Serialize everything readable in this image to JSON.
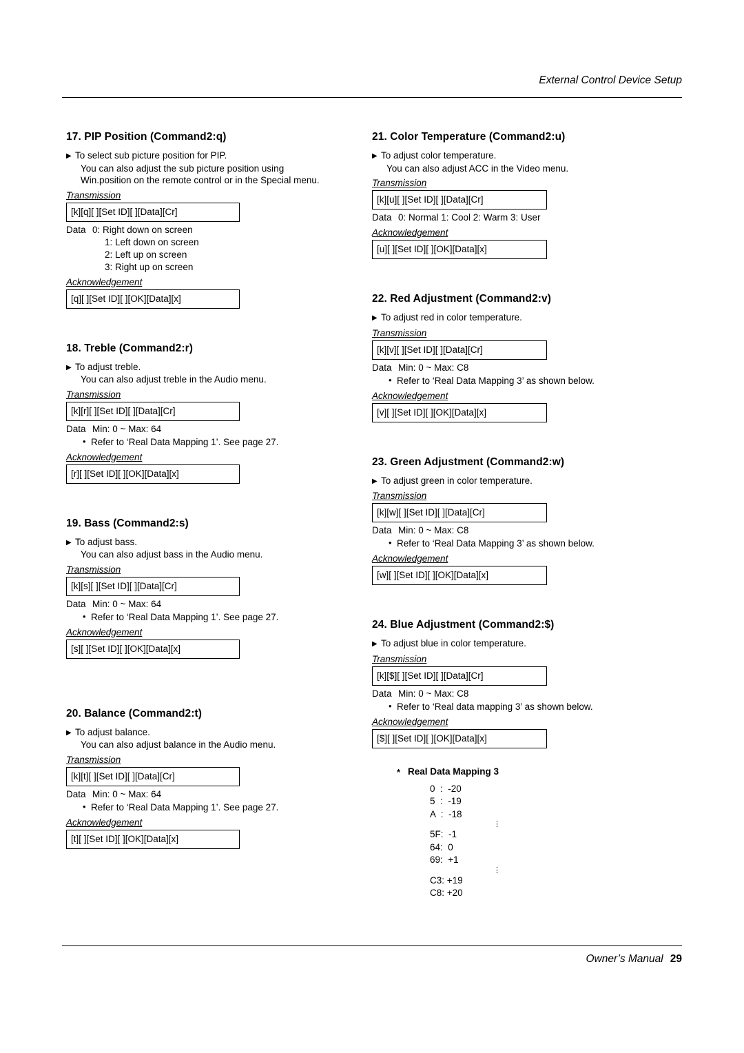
{
  "header": {
    "title": "External Control Device Setup"
  },
  "footer": {
    "manual": "Owner’s Manual",
    "page": "29"
  },
  "left_column": {
    "sections": [
      {
        "title": "17. PIP Position (Command2:q)",
        "bullet": "To select sub picture position for PIP.",
        "sublines": [
          "You can also adjust the sub picture position using",
          "Win.position on the remote control or in the Special menu."
        ],
        "transmission_label": "Transmission",
        "transmission_code": "[k][q][  ][Set ID][  ][Data][Cr]",
        "data_label": "Data",
        "data_value": "0: Right down on screen",
        "data_list": [
          "1: Left down on screen",
          "2: Left up on screen",
          "3: Right up on screen"
        ],
        "ack_label": "Acknowledgement",
        "ack_code": "[q][  ][Set ID][  ][OK][Data][x]"
      },
      {
        "title": "18. Treble (Command2:r)",
        "bullet": "To adjust treble.",
        "sublines": [
          "You can also adjust treble in the Audio menu."
        ],
        "transmission_label": "Transmission",
        "transmission_code": "[k][r][  ][Set ID][  ][Data][Cr]",
        "data_label": "Data",
        "data_value": "Min: 0 ~ Max: 64",
        "note": "Refer to ‘Real Data Mapping 1’. See page 27.",
        "ack_label": "Acknowledgement",
        "ack_code": "[r][  ][Set ID][  ][OK][Data][x]"
      },
      {
        "title": "19. Bass (Command2:s)",
        "bullet": "To adjust bass.",
        "sublines": [
          "You can also adjust bass in the Audio menu."
        ],
        "transmission_label": "Transmission",
        "transmission_code": "[k][s][  ][Set ID][  ][Data][Cr]",
        "data_label": "Data",
        "data_value": "Min: 0 ~ Max: 64",
        "note": "Refer to ‘Real Data Mapping 1’. See page 27.",
        "ack_label": "Acknowledgement",
        "ack_code": "[s][  ][Set ID][  ][OK][Data][x]"
      },
      {
        "title": "20. Balance (Command2:t)",
        "bullet": "To adjust balance.",
        "sublines": [
          "You can also adjust balance in the Audio menu."
        ],
        "transmission_label": "Transmission",
        "transmission_code": "[k][t][  ][Set ID][  ][Data][Cr]",
        "data_label": "Data",
        "data_value": "Min: 0 ~ Max: 64",
        "note": "Refer to ‘Real Data Mapping 1’. See page 27.",
        "ack_label": "Acknowledgement",
        "ack_code": "[t][  ][Set ID][  ][OK][Data][x]"
      }
    ]
  },
  "right_column": {
    "sections": [
      {
        "title": "21. Color Temperature (Command2:u)",
        "bullet": "To adjust color temperature.",
        "sublines": [
          "You can also adjust ACC in the Video menu."
        ],
        "transmission_label": "Transmission",
        "transmission_code": "[k][u][  ][Set ID][  ][Data][Cr]",
        "data_label": "Data",
        "data_value": "0: Normal      1: Cool      2: Warm      3: User",
        "ack_label": "Acknowledgement",
        "ack_code": "[u][  ][Set ID][  ][OK][Data][x]"
      },
      {
        "title": "22. Red Adjustment (Command2:v)",
        "bullet": "To adjust red in color temperature.",
        "transmission_label": "Transmission",
        "transmission_code": "[k][v][  ][Set ID][  ][Data][Cr]",
        "data_label": "Data",
        "data_value": "Min: 0 ~ Max: C8",
        "note": "Refer to ‘Real Data Mapping 3’ as shown below.",
        "ack_label": "Acknowledgement",
        "ack_code": "[v][  ][Set ID][  ][OK][Data][x]"
      },
      {
        "title": "23. Green Adjustment (Command2:w)",
        "bullet": "To adjust green in color temperature.",
        "transmission_label": "Transmission",
        "transmission_code": "[k][w][  ][Set ID][  ][Data][Cr]",
        "data_label": "Data",
        "data_value": "Min: 0 ~ Max: C8",
        "note": "Refer to ‘Real Data Mapping 3’ as shown below.",
        "ack_label": "Acknowledgement",
        "ack_code": "[w][  ][Set ID][  ][OK][Data][x]"
      },
      {
        "title": "24. Blue Adjustment (Command2:$)",
        "bullet": "To adjust blue in color temperature.",
        "transmission_label": "Transmission",
        "transmission_code": "[k][$][  ][Set ID][  ][Data][Cr]",
        "data_label": "Data",
        "data_value": "Min: 0 ~ Max: C8",
        "note": "Refer to ‘Real data mapping  3’ as shown below.",
        "ack_label": "Acknowledgement",
        "ack_code": "[$][  ][Set ID][  ][OK][Data][x]"
      }
    ],
    "real_data_mapping": {
      "title": "Real Data Mapping 3",
      "rows": [
        "0  :  -20",
        "5  :  -19",
        "A  :  -18"
      ],
      "ellipsis1": "⋮",
      "rows2": [
        "5F:  -1",
        "64:  0",
        "69:  +1"
      ],
      "ellipsis2": "⋮",
      "rows3": [
        "C3: +19",
        "C8: +20"
      ]
    }
  }
}
